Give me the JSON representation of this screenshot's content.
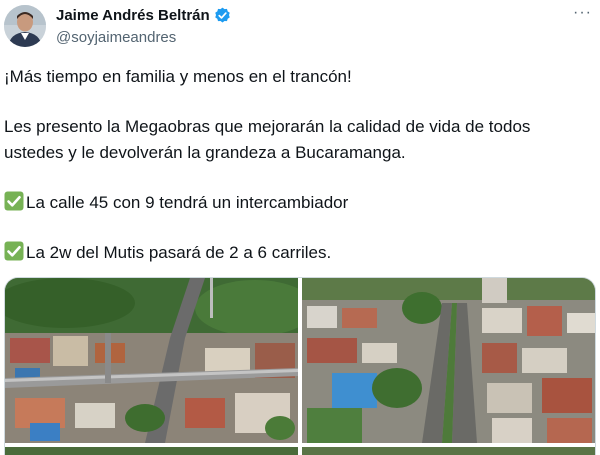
{
  "author": {
    "name": "Jaime Andrés Beltrán",
    "handle": "@soyjaimeandres",
    "verified_icon": "verified-badge-icon",
    "verified_color": "#1d9bf0"
  },
  "menu": {
    "more_label": "···"
  },
  "tweet": {
    "line1": "¡Más tiempo en familia y menos en el trancón!",
    "line2": "Les presento la Megaobras que mejorarán la calidad de vida de todos",
    "line3": "ustedes y le devolverán la grandeza a Bucaramanga.",
    "item1": "La calle 45 con 9 tendrá un intercambiador",
    "item2": "La 2w del Mutis pasará de 2 a 6 carriles.",
    "check_icon": "check-mark-button-icon",
    "check_color": "#77b255"
  },
  "media": {
    "images": [
      "aerial-overpass-photo",
      "aerial-avenue-photo",
      "aerial-photo-3",
      "aerial-photo-4"
    ]
  }
}
